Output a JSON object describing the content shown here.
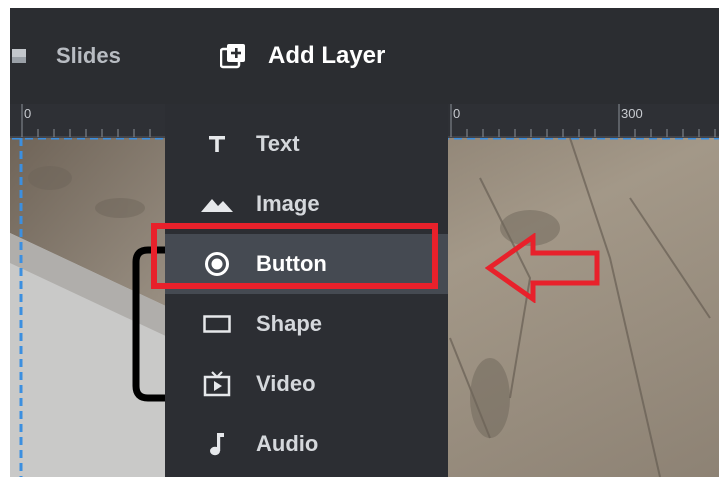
{
  "toolbar": {
    "slides_label": "Slides",
    "slides_icon": "image-icon",
    "add_layer_label": "Add Layer",
    "add_layer_icon": "add-layer-icon"
  },
  "ruler": {
    "labels": [
      "0",
      "0",
      "300"
    ]
  },
  "menu": {
    "items": [
      {
        "label": "Text",
        "icon": "text-icon"
      },
      {
        "label": "Image",
        "icon": "mountain-icon"
      },
      {
        "label": "Button",
        "icon": "radio-button-icon",
        "active": true
      },
      {
        "label": "Shape",
        "icon": "rectangle-icon"
      },
      {
        "label": "Video",
        "icon": "tv-play-icon"
      },
      {
        "label": "Audio",
        "icon": "music-note-icon"
      }
    ]
  },
  "colors": {
    "toolbar_bg": "#2b2d31",
    "menu_bg": "#2c2e33",
    "active_bg": "#454a52",
    "annotation_red": "#e8212b",
    "guide_blue": "#3b8fe0"
  }
}
